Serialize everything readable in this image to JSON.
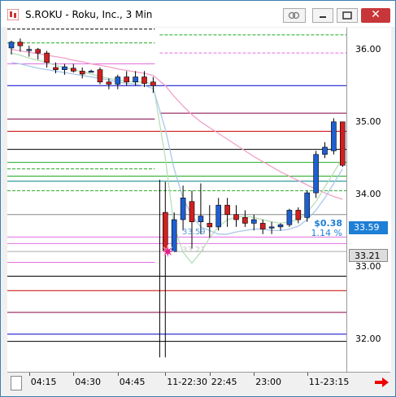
{
  "window": {
    "title": "S.ROKU - Roku, Inc., 3 Min",
    "close_label": "✕"
  },
  "colors": {
    "up_candle": "#1e5fd0",
    "down_candle": "#d02020",
    "ma_light_blue": "#a9c8e8",
    "ma_pink": "#f0a0c8",
    "ma_light_green": "#b8dfb8",
    "change_text": "#1e7fd6"
  },
  "price_change": {
    "amount": "$0.38",
    "percent": "1.14 %"
  },
  "price_boxes": {
    "last": "33.59",
    "reference": "33.21"
  },
  "annotations": {
    "level_a": "33.59",
    "level_b": "33.21"
  },
  "chart_data": {
    "type": "candlestick",
    "y_ticks": [
      "36.00",
      "35.00",
      "34.00",
      "33.00",
      "32.00"
    ],
    "ylim": [
      31.55,
      36.3
    ],
    "x_ticks": [
      "04:15",
      "04:30",
      "04:45",
      "11-22:30",
      "22:45",
      "23:00",
      "11-23:15"
    ],
    "session_divider_after_index": 16,
    "candles": [
      {
        "o": 36.02,
        "h": 36.12,
        "l": 35.93,
        "c": 36.1
      },
      {
        "o": 36.1,
        "h": 36.15,
        "l": 35.97,
        "c": 36.05
      },
      {
        "o": 36.0,
        "h": 36.05,
        "l": 35.9,
        "c": 36.0
      },
      {
        "o": 36.0,
        "h": 36.02,
        "l": 35.86,
        "c": 35.95
      },
      {
        "o": 35.95,
        "h": 35.98,
        "l": 35.75,
        "c": 35.82
      },
      {
        "o": 35.75,
        "h": 35.82,
        "l": 35.67,
        "c": 35.72
      },
      {
        "o": 35.72,
        "h": 35.8,
        "l": 35.65,
        "c": 35.76
      },
      {
        "o": 35.74,
        "h": 35.8,
        "l": 35.68,
        "c": 35.7
      },
      {
        "o": 35.7,
        "h": 35.75,
        "l": 35.6,
        "c": 35.66
      },
      {
        "o": 35.7,
        "h": 35.72,
        "l": 35.7,
        "c": 35.7
      },
      {
        "o": 35.72,
        "h": 35.75,
        "l": 35.52,
        "c": 35.55
      },
      {
        "o": 35.55,
        "h": 35.6,
        "l": 35.45,
        "c": 35.52
      },
      {
        "o": 35.52,
        "h": 35.65,
        "l": 35.45,
        "c": 35.62
      },
      {
        "o": 35.62,
        "h": 35.7,
        "l": 35.5,
        "c": 35.55
      },
      {
        "o": 35.55,
        "h": 35.7,
        "l": 35.5,
        "c": 35.62
      },
      {
        "o": 35.62,
        "h": 35.7,
        "l": 35.48,
        "c": 35.53
      },
      {
        "o": 35.55,
        "h": 35.62,
        "l": 35.4,
        "c": 35.5
      },
      {
        "o": 33.75,
        "h": 34.17,
        "l": 31.75,
        "c": 33.21
      },
      {
        "o": 33.21,
        "h": 33.75,
        "l": 33.2,
        "c": 33.65
      },
      {
        "o": 33.65,
        "h": 34.12,
        "l": 33.5,
        "c": 33.95
      },
      {
        "o": 33.9,
        "h": 34.05,
        "l": 33.25,
        "c": 33.62
      },
      {
        "o": 33.62,
        "h": 34.15,
        "l": 33.45,
        "c": 33.7
      },
      {
        "o": 33.6,
        "h": 33.85,
        "l": 33.4,
        "c": 33.55
      },
      {
        "o": 33.55,
        "h": 33.95,
        "l": 33.5,
        "c": 33.85
      },
      {
        "o": 33.85,
        "h": 33.95,
        "l": 33.55,
        "c": 33.72
      },
      {
        "o": 33.72,
        "h": 33.85,
        "l": 33.55,
        "c": 33.65
      },
      {
        "o": 33.68,
        "h": 33.78,
        "l": 33.55,
        "c": 33.6
      },
      {
        "o": 33.6,
        "h": 33.72,
        "l": 33.5,
        "c": 33.65
      },
      {
        "o": 33.6,
        "h": 33.65,
        "l": 33.45,
        "c": 33.52
      },
      {
        "o": 33.55,
        "h": 33.62,
        "l": 33.45,
        "c": 33.55
      },
      {
        "o": 33.55,
        "h": 33.6,
        "l": 33.5,
        "c": 33.58
      },
      {
        "o": 33.58,
        "h": 33.8,
        "l": 33.55,
        "c": 33.78
      },
      {
        "o": 33.78,
        "h": 33.82,
        "l": 33.6,
        "c": 33.65
      },
      {
        "o": 33.68,
        "h": 34.05,
        "l": 33.62,
        "c": 34.02
      },
      {
        "o": 34.02,
        "h": 34.6,
        "l": 33.95,
        "c": 34.55
      },
      {
        "o": 34.55,
        "h": 34.72,
        "l": 34.5,
        "c": 34.65
      },
      {
        "o": 34.6,
        "h": 35.05,
        "l": 34.55,
        "c": 35.0
      },
      {
        "o": 35.0,
        "h": 35.0,
        "l": 34.38,
        "c": 34.4
      }
    ],
    "levels": [
      {
        "y": 36.28,
        "color": "#000000",
        "dash": true,
        "side": "left"
      },
      {
        "y": 36.2,
        "color": "#22aa22",
        "dash": true,
        "side": "right"
      },
      {
        "y": 36.09,
        "color": "#22aa22",
        "dash": true,
        "side": "left"
      },
      {
        "y": 35.95,
        "color": "#e070e0",
        "dash": true,
        "side": "right"
      },
      {
        "y": 35.8,
        "color": "#e070e0",
        "dash": false,
        "side": "left"
      },
      {
        "y": 35.5,
        "color": "#0000cc",
        "dash": false,
        "side": "both"
      },
      {
        "y": 35.12,
        "color": "#800040",
        "dash": false,
        "side": "right"
      },
      {
        "y": 35.04,
        "color": "#800040",
        "dash": false,
        "side": "left"
      },
      {
        "y": 34.87,
        "color": "#cc0000",
        "dash": false,
        "side": "both"
      },
      {
        "y": 34.62,
        "color": "#000000",
        "dash": false,
        "side": "both"
      },
      {
        "y": 34.44,
        "color": "#22aa22",
        "dash": false,
        "side": "both"
      },
      {
        "y": 34.35,
        "color": "#22aa22",
        "dash": true,
        "side": "left"
      },
      {
        "y": 34.25,
        "color": "#22aa22",
        "dash": false,
        "side": "both"
      },
      {
        "y": 34.18,
        "color": "#008080",
        "dash": false,
        "side": "both"
      },
      {
        "y": 34.05,
        "color": "#22aa22",
        "dash": true,
        "side": "both"
      },
      {
        "y": 33.72,
        "color": "#888888",
        "dash": false,
        "side": "both"
      },
      {
        "y": 33.41,
        "color": "#e070e0",
        "dash": false,
        "side": "both"
      },
      {
        "y": 33.32,
        "color": "#e070e0",
        "dash": false,
        "side": "both"
      },
      {
        "y": 33.21,
        "color": "#aaaaaa",
        "dash": false,
        "side": "both"
      },
      {
        "y": 33.06,
        "color": "#e070e0",
        "dash": false,
        "side": "left"
      },
      {
        "y": 32.87,
        "color": "#000000",
        "dash": false,
        "side": "both"
      },
      {
        "y": 32.67,
        "color": "#cc0000",
        "dash": false,
        "side": "both"
      },
      {
        "y": 32.37,
        "color": "#800040",
        "dash": false,
        "side": "both"
      },
      {
        "y": 32.07,
        "color": "#0000cc",
        "dash": false,
        "side": "both"
      },
      {
        "y": 31.97,
        "color": "#000000",
        "dash": false,
        "side": "both"
      }
    ],
    "ma_blue": [
      35.82,
      35.8,
      35.77,
      35.74,
      35.72,
      35.7,
      35.68,
      35.66,
      35.64,
      35.62,
      35.6,
      35.58,
      35.55,
      35.53,
      35.52,
      35.5,
      35.46,
      34.9,
      34.35,
      33.95,
      33.7,
      33.55,
      33.5,
      33.45,
      33.45,
      33.48,
      33.5,
      33.52,
      33.52,
      33.5,
      33.5,
      33.52,
      33.56,
      33.65,
      33.78,
      33.95,
      34.15,
      34.35
    ],
    "ma_pink": [
      36.0,
      35.98,
      35.96,
      35.94,
      35.92,
      35.9,
      35.88,
      35.85,
      35.83,
      35.8,
      35.78,
      35.76,
      35.73,
      35.71,
      35.69,
      35.67,
      35.64,
      35.5,
      35.35,
      35.22,
      35.1,
      35.0,
      34.92,
      34.84,
      34.76,
      34.68,
      34.6,
      34.52,
      34.45,
      34.38,
      34.31,
      34.25,
      34.19,
      34.13,
      34.07,
      34.02,
      33.97,
      33.93
    ],
    "ma_green": [
      35.95,
      35.92,
      35.88,
      35.85,
      35.82,
      35.78,
      35.75,
      35.72,
      35.69,
      35.66,
      35.63,
      35.6,
      35.58,
      35.56,
      35.55,
      35.55,
      35.52,
      34.5,
      33.55,
      33.2,
      33.05,
      33.2,
      33.4,
      33.55,
      33.65,
      33.68,
      33.7,
      33.68,
      33.65,
      33.62,
      33.6,
      33.62,
      33.65,
      33.75,
      33.9,
      34.1,
      34.3,
      34.5
    ]
  }
}
